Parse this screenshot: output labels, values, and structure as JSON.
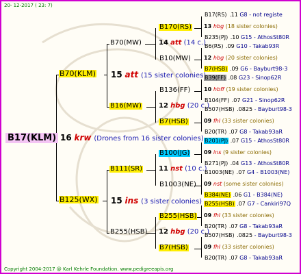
{
  "header_date": "20- 12-2017 ( 23: 7)",
  "footer": "Copyright 2004-2017 @ Karl Kehrle Foundation.   www.pedigreeapis.org",
  "root": {
    "name": "B17(KLM)",
    "count": "16",
    "station": "krw",
    "note": "(Drones from 16 sister colonies)"
  },
  "gen2": [
    {
      "name": "B70(KLM)",
      "count": "15",
      "station": "att",
      "note": "(15 sister colonies)"
    },
    {
      "name": "B125(WX)",
      "count": "15",
      "station": "ins",
      "note": "(3 sister colonies)"
    }
  ],
  "gen3": [
    {
      "name": "B70(MW)"
    },
    {
      "name": "B16(MW)"
    },
    {
      "name": "B111(SR)"
    },
    {
      "name": "B255(HSB)"
    }
  ],
  "gen4": [
    {
      "name": "B170(RS)"
    },
    {
      "name": "B10(MW)"
    },
    {
      "name": "B136(FF)"
    },
    {
      "name": "B7(HSB)"
    },
    {
      "name": "B100(JG)"
    },
    {
      "name": "B1003(NE)"
    },
    {
      "name": "B255(HSB)"
    },
    {
      "name": "B7(HSB)"
    }
  ],
  "gen4m": [
    {
      "count": "14",
      "station": "att",
      "note": "(14 c.)"
    },
    {
      "count": "12",
      "station": "hbg",
      "note": "(20 c.)"
    },
    {
      "count": "11",
      "station": "nst",
      "note": "(10 c.)"
    },
    {
      "count": "12",
      "station": "hbg",
      "note": "(20 c.)"
    }
  ],
  "gen5": [
    {
      "name": "B17(RS)",
      "val": ".11",
      "code": "G8 - not registe",
      "hl": ""
    },
    {
      "count": "13",
      "station": "hbg",
      "note": "(18 sister colonies)"
    },
    {
      "name": "B235(PJ)",
      "val": ".10",
      "code": "G15 - AthosSt80R",
      "hl": ""
    },
    {
      "name": "B6(RS)",
      "val": ".09",
      "code": "G10 - Takab93R",
      "hl": ""
    },
    {
      "count": "12",
      "station": "hbg",
      "note": "(20 sister colonies)"
    },
    {
      "name": "B7(HSB)",
      "val": ".09",
      "code": "G6 - Bayburt98-3",
      "hl": "y"
    },
    {
      "name": "B39(FF)",
      "val": ".08",
      "code": "G23 - Sinop62R",
      "hl": "gr"
    },
    {
      "count": "10",
      "station": "hbff",
      "note": "(19 sister colonies)"
    },
    {
      "name": "B104(FF)",
      "val": ".07",
      "code": "G21 - Sinop62R",
      "hl": ""
    },
    {
      "name": "B507(HSB)",
      "val": ".0825",
      "code": "- Bayburt98-3",
      "hl": ""
    },
    {
      "count": "09",
      "station": "fhl",
      "note": "(33 sister colonies)"
    },
    {
      "name": "B20(TR)",
      "val": ".07",
      "code": "G8 - Takab93aR",
      "hl": ""
    },
    {
      "name": "B201(PJ)",
      "val": ".07",
      "code": "G15 - AthosSt80R",
      "hl": "bl"
    },
    {
      "count": "09",
      "station": "ins",
      "note": "(9 sister colonies)"
    },
    {
      "name": "B271(PJ)",
      "val": ".04",
      "code": "G13 - AthosSt80R",
      "hl": ""
    },
    {
      "name": "B1003(NE)",
      "val": ".07",
      "code": "G4 - B1003(NE)",
      "hl": ""
    },
    {
      "count": "09",
      "station": "nst",
      "note": "(some sister colonies)"
    },
    {
      "name": "B384(NE)",
      "val": ".06",
      "code": "G1 - B384(NE)",
      "hl": "y"
    },
    {
      "name": "B255(HSB)",
      "val": ".07",
      "code": "G7 - Cankiri97Q",
      "hl": "y"
    },
    {
      "count": "09",
      "station": "fhl",
      "note": "(33 sister colonies)"
    },
    {
      "name": "B20(TR)",
      "val": ".07",
      "code": "G8 - Takab93aR",
      "hl": ""
    },
    {
      "name": "B507(HSB)",
      "val": ".0825",
      "code": "- Bayburt98-3",
      "hl": ""
    },
    {
      "count": "09",
      "station": "fhl",
      "note": "(33 sister colonies)"
    },
    {
      "name": "B20(TR)",
      "val": ".07",
      "code": "G8 - Takab93aR",
      "hl": ""
    }
  ]
}
